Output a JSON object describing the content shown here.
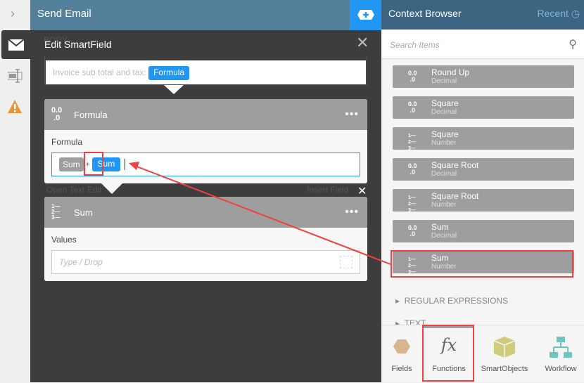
{
  "header": {
    "title": "Send Email"
  },
  "background": {
    "section_label": "BODY",
    "open_text_editor": "Open Text Edit",
    "insert_field": "Insert Field"
  },
  "dialog": {
    "title": "Edit SmartField",
    "preview_label": "Invoice sub total and tax:",
    "preview_chip": "Formula"
  },
  "formula_card": {
    "title": "Formula",
    "field_label": "Formula",
    "tokens": [
      "Sum",
      "+",
      "Sum"
    ]
  },
  "sum_card": {
    "title": "Sum",
    "field_label": "Values",
    "placeholder": "Type / Drop"
  },
  "context_browser": {
    "title": "Context Browser",
    "recent": "Recent",
    "search_placeholder": "Search Items",
    "items": [
      {
        "name": "Round Up",
        "type": "Decimal",
        "icon": "decimal-icon"
      },
      {
        "name": "Square",
        "type": "Decimal",
        "icon": "decimal-icon"
      },
      {
        "name": "Square",
        "type": "Number",
        "icon": "number-list-icon"
      },
      {
        "name": "Square Root",
        "type": "Decimal",
        "icon": "decimal-icon"
      },
      {
        "name": "Square Root",
        "type": "Number",
        "icon": "number-list-icon"
      },
      {
        "name": "Sum",
        "type": "Decimal",
        "icon": "decimal-icon"
      },
      {
        "name": "Sum",
        "type": "Number",
        "icon": "number-list-icon"
      }
    ],
    "categories": [
      "REGULAR EXPRESSIONS",
      "TEXT"
    ],
    "tabs": [
      "Fields",
      "Functions",
      "SmartObjects",
      "Workflow"
    ]
  },
  "colors": {
    "accent": "#2196f3",
    "header": "#527f99",
    "annotation": "#f04040"
  }
}
